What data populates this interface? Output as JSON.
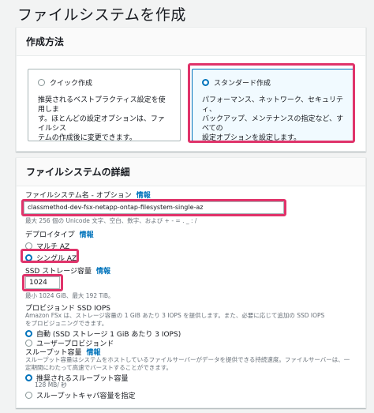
{
  "page": {
    "title": "ファイルシステムを作成"
  },
  "creation_method": {
    "header": "作成方法",
    "quick": {
      "label": "クイック作成",
      "desc_1": "推奨されるベストプラクティス設定を使用しま",
      "desc_2": "す。ほとんどの設定オプションは、ファイルシス",
      "desc_3": "テムの作成後に変更できます。"
    },
    "standard": {
      "label": "スタンダード作成",
      "desc_1": "パフォーマンス、ネットワーク、セキュリティ、",
      "desc_2": "バックアップ、メンテナンスの指定など、すべての",
      "desc_3": "設定オプションを設定します。"
    }
  },
  "details": {
    "header": "ファイルシステムの詳細",
    "info_link": "情報",
    "name_label": "ファイルシステム名 - オプション",
    "name_value": "classmethod-dev-fsx-netapp-ontap-filesystem-single-az",
    "name_hint": "最大 256 個の Unicode 文字、空白、数字、および + - = . _ : /",
    "deploy_label": "デプロイタイプ",
    "deploy_multi": "マルチ AZ",
    "deploy_single": "シングル AZ",
    "ssd_label": "SSD ストレージ容量",
    "ssd_value": "1024",
    "ssd_hint": "最小 1024 GiB、最大 192 TiB。",
    "iops_label": "プロビジョンド SSD IOPS",
    "iops_hint_1": "Amazon FSx は、ストレージ容量の 1 GiB あたり 3 IOPS を提供します。また、必要に応じて追加の SSD IOPS",
    "iops_hint_2": "をプロビジョニングできます。",
    "iops_auto": "自動 (SSD ストレージ 1 GiB あたり 3 IOPS)",
    "iops_user": "ユーザープロビジョンド",
    "throughput_label": "スループット容量",
    "throughput_hint_1": "スループット容量はシステムをホストしているファイルサーバーがデータを提供できる持続速度。ファイルサーバーは、一",
    "throughput_hint_2": "定期間にわたって高速でバーストすることができます。",
    "throughput_recommended": "推奨されるスループット容量",
    "throughput_recommended_value": "128 MB/ 秒",
    "throughput_specify": "スループットキャパ容量を指定"
  }
}
